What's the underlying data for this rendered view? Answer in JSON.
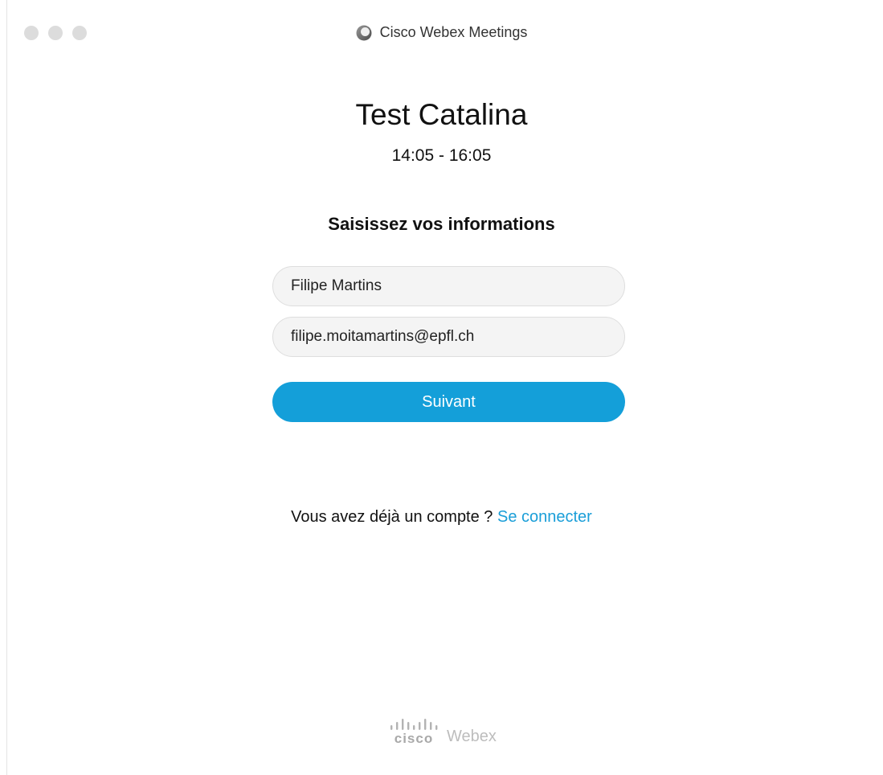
{
  "window": {
    "title": "Cisco Webex Meetings",
    "icon": "webex-app-icon"
  },
  "meeting": {
    "title": "Test Catalina",
    "time": "14:05 - 16:05"
  },
  "form": {
    "heading": "Saisissez vos informations",
    "name_value": "Filipe Martins",
    "email_value": "filipe.moitamartins@epfl.ch",
    "next_label": "Suivant"
  },
  "account": {
    "prompt": "Vous avez déjà un compte ?",
    "login_link": "Se connecter"
  },
  "footer": {
    "brand": "cisco",
    "product": "Webex"
  },
  "colors": {
    "accent": "#149fd9",
    "link": "#1a9ed8"
  }
}
